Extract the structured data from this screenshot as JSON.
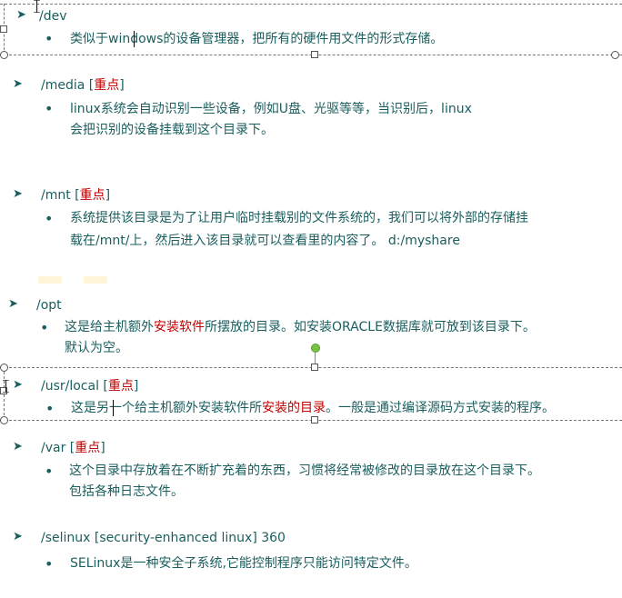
{
  "sections": [
    {
      "id": "dev",
      "heading": [
        {
          "text": "/dev",
          "red": false
        }
      ],
      "lines": [
        [
          {
            "text": "类似于windows的设备管理器，把所有的硬件用文件的形式存储。",
            "red": false
          }
        ]
      ]
    },
    {
      "id": "media",
      "heading": [
        {
          "text": "/media [",
          "red": false
        },
        {
          "text": "重点",
          "red": true
        },
        {
          "text": "]",
          "red": false
        }
      ],
      "lines": [
        [
          {
            "text": "linux系统会自动识别一些设备，例如U盘、光驱等等，当识别后，linux",
            "red": false
          }
        ],
        [
          {
            "text": "会把识别的设备挂载到这个目录下。",
            "red": false
          }
        ]
      ]
    },
    {
      "id": "mnt",
      "heading": [
        {
          "text": "/mnt [",
          "red": false
        },
        {
          "text": "重点",
          "red": true
        },
        {
          "text": "]",
          "red": false
        }
      ],
      "lines": [
        [
          {
            "text": "系统提供该目录是为了让用户临时挂载别的文件系统的，我们可以将外部的存储挂",
            "red": false
          }
        ],
        [
          {
            "text": "载在/mnt/上，然后进入该目录就可以查看里的内容了。 d:/myshare",
            "red": false
          }
        ]
      ]
    },
    {
      "id": "opt",
      "heading": [
        {
          "text": "/opt",
          "red": false
        }
      ],
      "lines": [
        [
          {
            "text": "这是给主机额外",
            "red": false
          },
          {
            "text": "安装软件",
            "red": true
          },
          {
            "text": "所摆放的目录。如安装ORACLE数据库就可放到该目录下。",
            "red": false
          }
        ],
        [
          {
            "text": "默认为空。",
            "red": false
          }
        ]
      ]
    },
    {
      "id": "usrlocal",
      "heading": [
        {
          "text": "/usr/local  [",
          "red": false
        },
        {
          "text": "重点",
          "red": true
        },
        {
          "text": "]",
          "red": false
        }
      ],
      "lines": [
        [
          {
            "text": "这是另一个给主机额外安装软件所",
            "red": false
          },
          {
            "text": "安装的目录",
            "red": true
          },
          {
            "text": "。一般是通过编译源码方式安装的程序。",
            "red": false
          }
        ]
      ]
    },
    {
      "id": "var",
      "heading": [
        {
          "text": "/var [",
          "red": false
        },
        {
          "text": "重点",
          "red": true
        },
        {
          "text": "]",
          "red": false
        }
      ],
      "lines": [
        [
          {
            "text": "这个目录中存放着在不断扩充着的东西，习惯将经常被修改的目录放在这个目录下。",
            "red": false
          }
        ],
        [
          {
            "text": "包括各种日志文件。",
            "red": false
          }
        ]
      ]
    },
    {
      "id": "selinux",
      "heading": [
        {
          "text": "/selinux [security-enhanced  linux] 360",
          "red": false
        }
      ],
      "lines": [
        [
          {
            "text": "SELinux是一种安全子系统,它能控制程序只能访问特定文件。",
            "red": false
          }
        ]
      ]
    }
  ],
  "colors": {
    "text": "#1a5e5e",
    "emphasis": "#c00000",
    "rotate_handle": "#7ac143"
  },
  "icons": {
    "heading_marker": "arrow-bullet-icon",
    "list_marker": "round-bullet-icon"
  }
}
